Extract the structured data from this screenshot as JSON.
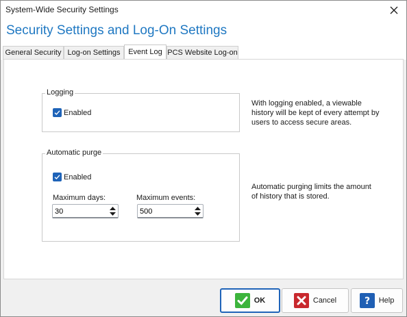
{
  "window": {
    "title": "System-Wide Security Settings",
    "heading": "Security Settings and Log-On Settings"
  },
  "tabs": [
    {
      "label": "General Security",
      "active": false
    },
    {
      "label": "Log-on Settings",
      "active": false
    },
    {
      "label": "Event Log",
      "active": true
    },
    {
      "label": "PCS Website Log-on",
      "active": false
    }
  ],
  "logging": {
    "legend": "Logging",
    "enabled_label": "Enabled",
    "enabled": true,
    "description": "With logging enabled, a viewable history will be kept of every attempt by users to access secure areas."
  },
  "purge": {
    "legend": "Automatic purge",
    "enabled_label": "Enabled",
    "enabled": true,
    "max_days_label": "Maximum days:",
    "max_days_value": "30",
    "max_events_label": "Maximum events:",
    "max_events_value": "500",
    "description": "Automatic purging limits the amount of history that is stored."
  },
  "buttons": {
    "ok": "OK",
    "cancel": "Cancel",
    "help": "Help"
  },
  "colors": {
    "accent": "#1f78c2",
    "checkbox": "#1e63b8",
    "ok_icon": "#3cb43c",
    "cancel_icon": "#c8282d",
    "help_icon": "#1f5fb4"
  }
}
